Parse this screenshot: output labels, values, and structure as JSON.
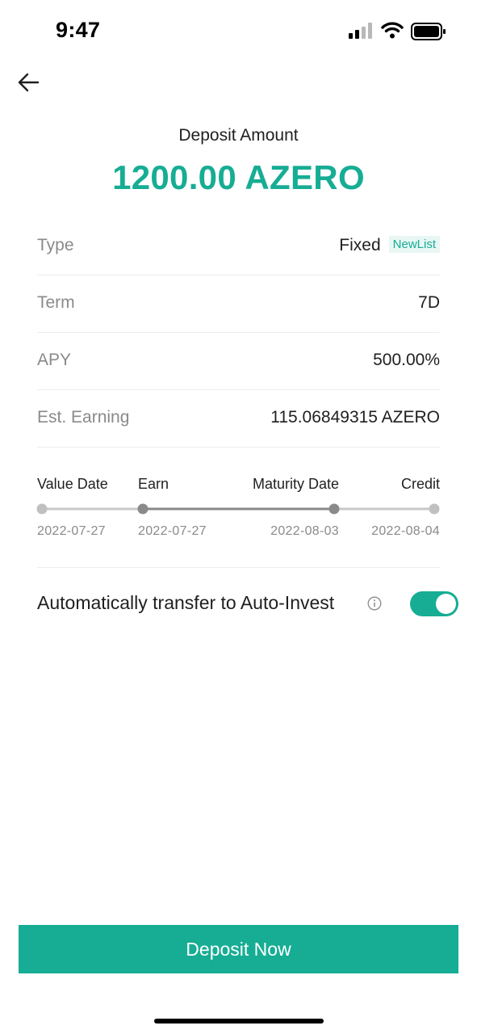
{
  "status_bar": {
    "time": "9:47"
  },
  "header": {
    "deposit_label": "Deposit Amount",
    "deposit_amount": "1200.00 AZERO"
  },
  "details": {
    "type": {
      "label": "Type",
      "value": "Fixed",
      "tag": "NewList"
    },
    "term": {
      "label": "Term",
      "value": "7D"
    },
    "apy": {
      "label": "APY",
      "value": "500.00%"
    },
    "earning": {
      "label": "Est. Earning",
      "value": "115.06849315 AZERO"
    }
  },
  "timeline": {
    "steps": [
      {
        "label": "Value Date",
        "date": "2022-07-27"
      },
      {
        "label": "Earn",
        "date": "2022-07-27"
      },
      {
        "label": "Maturity Date",
        "date": "2022-08-03"
      },
      {
        "label": "Credit",
        "date": "2022-08-04"
      }
    ]
  },
  "auto_invest": {
    "label": "Automatically transfer to Auto-Invest",
    "enabled": true
  },
  "cta": {
    "label": "Deposit Now"
  },
  "colors": {
    "accent": "#16ad94",
    "muted": "#8a8a8a",
    "track": "#c8c8c8",
    "track_active": "#8a8a8a"
  },
  "icons": [
    "back-arrow-icon",
    "cellular-signal-icon",
    "wifi-icon",
    "battery-icon",
    "info-icon"
  ]
}
